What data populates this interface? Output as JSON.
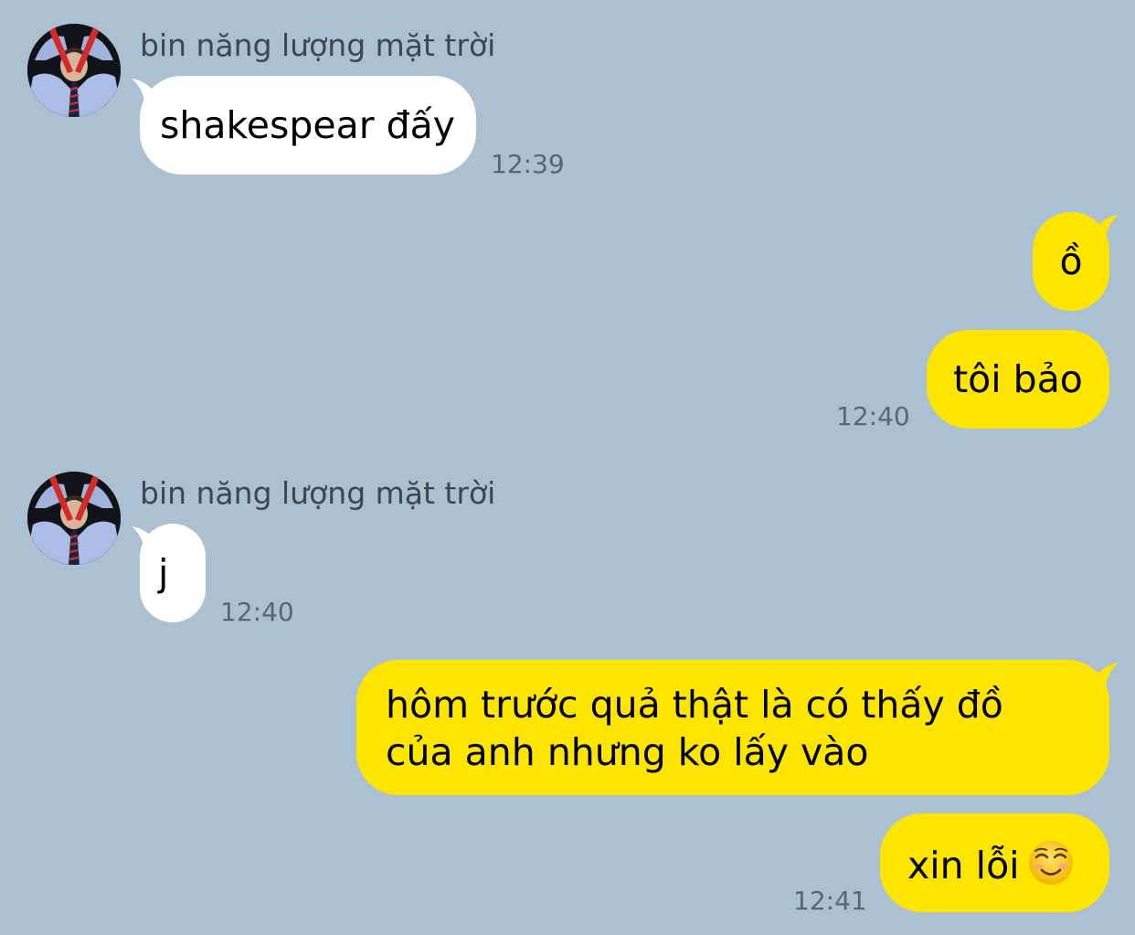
{
  "chat": {
    "partner_name": "bin năng lượng mặt trời",
    "messages": [
      {
        "text": "shakespear đấy",
        "time": "12:39"
      },
      {
        "text": "ồ"
      },
      {
        "text": "tôi bảo",
        "time": "12:40"
      },
      {
        "text": "j",
        "time": "12:40"
      },
      {
        "text": "hôm trước quả thật là có thấy đồ của anh nhưng ko lấy vào"
      },
      {
        "text": "xin lỗi",
        "emoji": "smiling-face-emoji",
        "time": "12:41"
      }
    ]
  },
  "colors": {
    "background": "#abc1d1",
    "outgoing_bubble": "#fee500",
    "incoming_bubble": "#ffffff"
  }
}
